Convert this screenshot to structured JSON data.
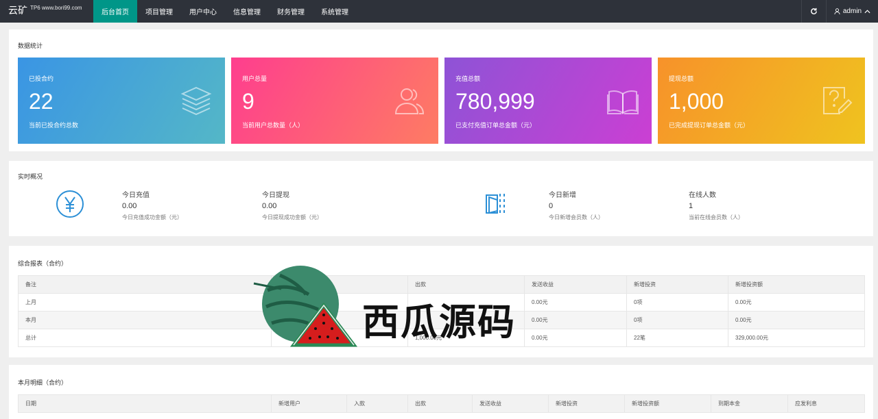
{
  "app": {
    "logo": "云矿",
    "site": "TP6 www.bori99.com"
  },
  "nav": [
    "后台首页",
    "项目管理",
    "用户中心",
    "信息管理",
    "财务管理",
    "系统管理"
  ],
  "header": {
    "user": "admin"
  },
  "stats": {
    "title": "数据统计",
    "cards": [
      {
        "label": "已投合约",
        "value": "22",
        "desc": "当前已投合约总数"
      },
      {
        "label": "用户总量",
        "value": "9",
        "desc": "当前用户总数量（人）"
      },
      {
        "label": "充值总额",
        "value": "780,999",
        "desc": "已支付充值订单总金额（元）"
      },
      {
        "label": "提现总额",
        "value": "1,000",
        "desc": "已完成提现订单总金额（元）"
      }
    ]
  },
  "realtime": {
    "title": "实时概况",
    "items": [
      {
        "label": "今日充值",
        "value": "0.00",
        "desc": "今日充值成功金额（元）"
      },
      {
        "label": "今日提现",
        "value": "0.00",
        "desc": "今日提现成功金额（元）"
      },
      {
        "label": "今日新增",
        "value": "0",
        "desc": "今日新增会员数（人）"
      },
      {
        "label": "在线人数",
        "value": "1",
        "desc": "当前在线会员数（人）"
      }
    ]
  },
  "report": {
    "title": "综合报表（合约）",
    "headers": [
      "备注",
      "",
      "出款",
      "发送收益",
      "新增投资",
      "新增投资额"
    ],
    "rows": [
      [
        "上月",
        "",
        "",
        "0.00元",
        "0项",
        "0.00元"
      ],
      [
        "本月",
        "",
        "",
        "0.00元",
        "0项",
        "0.00元"
      ],
      [
        "总计",
        "",
        "1,000.00元",
        "0.00元",
        "22笔",
        "329,000.00元"
      ]
    ]
  },
  "monthly": {
    "title": "本月明细（合约）",
    "headers": [
      "日期",
      "新增用户",
      "入款",
      "出款",
      "发送收益",
      "新增投资",
      "新增投资额",
      "到期本金",
      "应发利息"
    ]
  },
  "watermark": {
    "text": "西瓜源码"
  }
}
